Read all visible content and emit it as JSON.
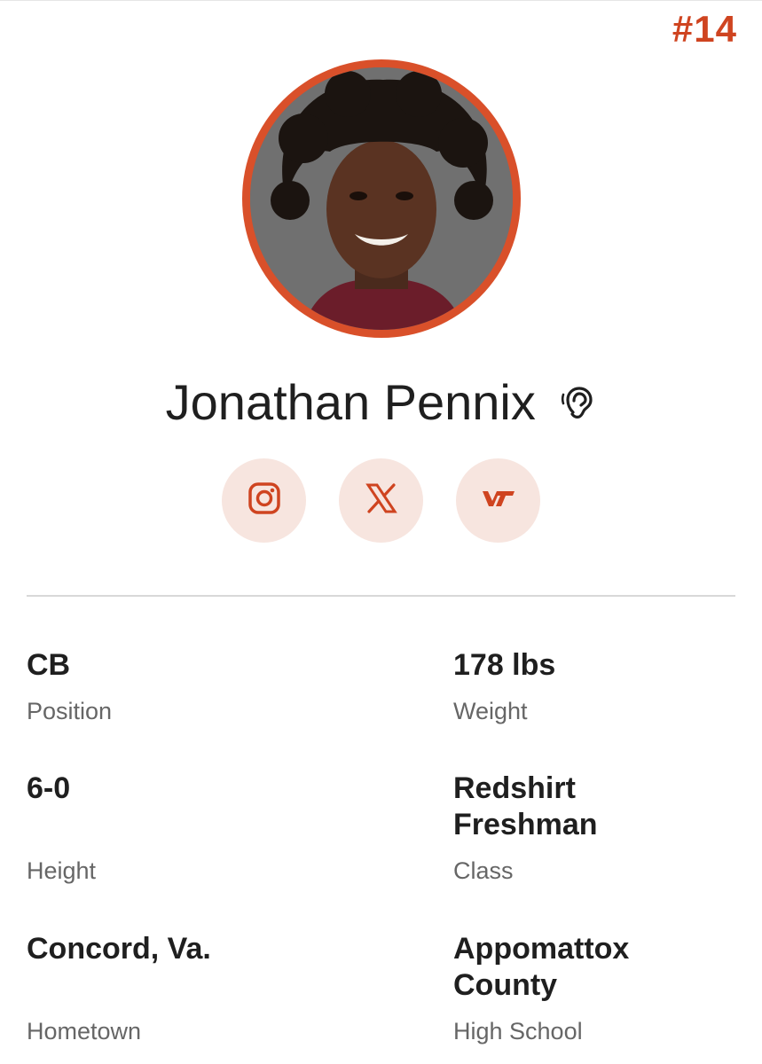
{
  "jersey_number": "#14",
  "player": {
    "name": "Jonathan Pennix"
  },
  "icons": {
    "audio": "ear-pronunciation-icon",
    "instagram": "instagram-icon",
    "x": "x-twitter-icon",
    "team": "vt-logo-icon"
  },
  "colors": {
    "accent": "#cf4420",
    "ring": "#d9502a",
    "social_bg": "#f7e5df",
    "label": "#666666"
  },
  "stats": [
    {
      "value": "CB",
      "label": "Position"
    },
    {
      "value": "178 lbs",
      "label": "Weight"
    },
    {
      "value": "6-0",
      "label": "Height"
    },
    {
      "value": "Redshirt Freshman",
      "label": "Class"
    },
    {
      "value": "Concord, Va.",
      "label": "Hometown"
    },
    {
      "value": "Appomattox County",
      "label": "High School"
    }
  ]
}
